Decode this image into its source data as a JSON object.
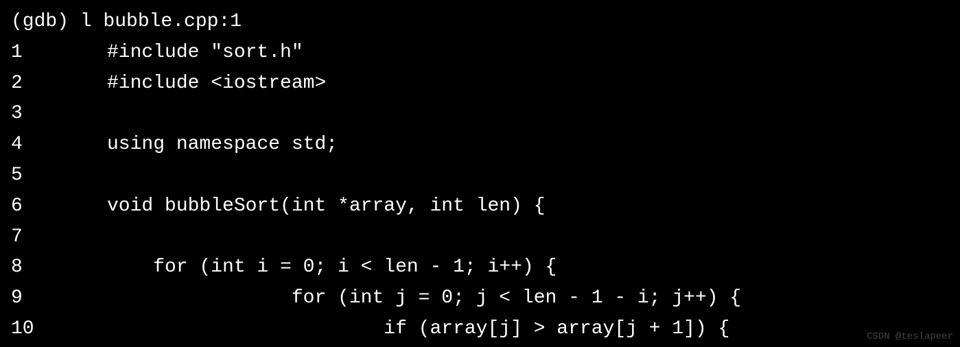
{
  "prompt": "(gdb) l bubble.cpp:1",
  "lines": [
    {
      "num": "1",
      "code": "#include \"sort.h\""
    },
    {
      "num": "2",
      "code": "#include <iostream>"
    },
    {
      "num": "3",
      "code": ""
    },
    {
      "num": "4",
      "code": "using namespace std;"
    },
    {
      "num": "5",
      "code": ""
    },
    {
      "num": "6",
      "code": "void bubbleSort(int *array, int len) {"
    },
    {
      "num": "7",
      "code": ""
    },
    {
      "num": "8",
      "code": "    for (int i = 0; i < len - 1; i++) {"
    },
    {
      "num": "9",
      "code": "                for (int j = 0; j < len - 1 - i; j++) {"
    },
    {
      "num": "10",
      "code": "                        if (array[j] > array[j + 1]) {"
    }
  ],
  "watermark": "CSDN @teslapeer"
}
